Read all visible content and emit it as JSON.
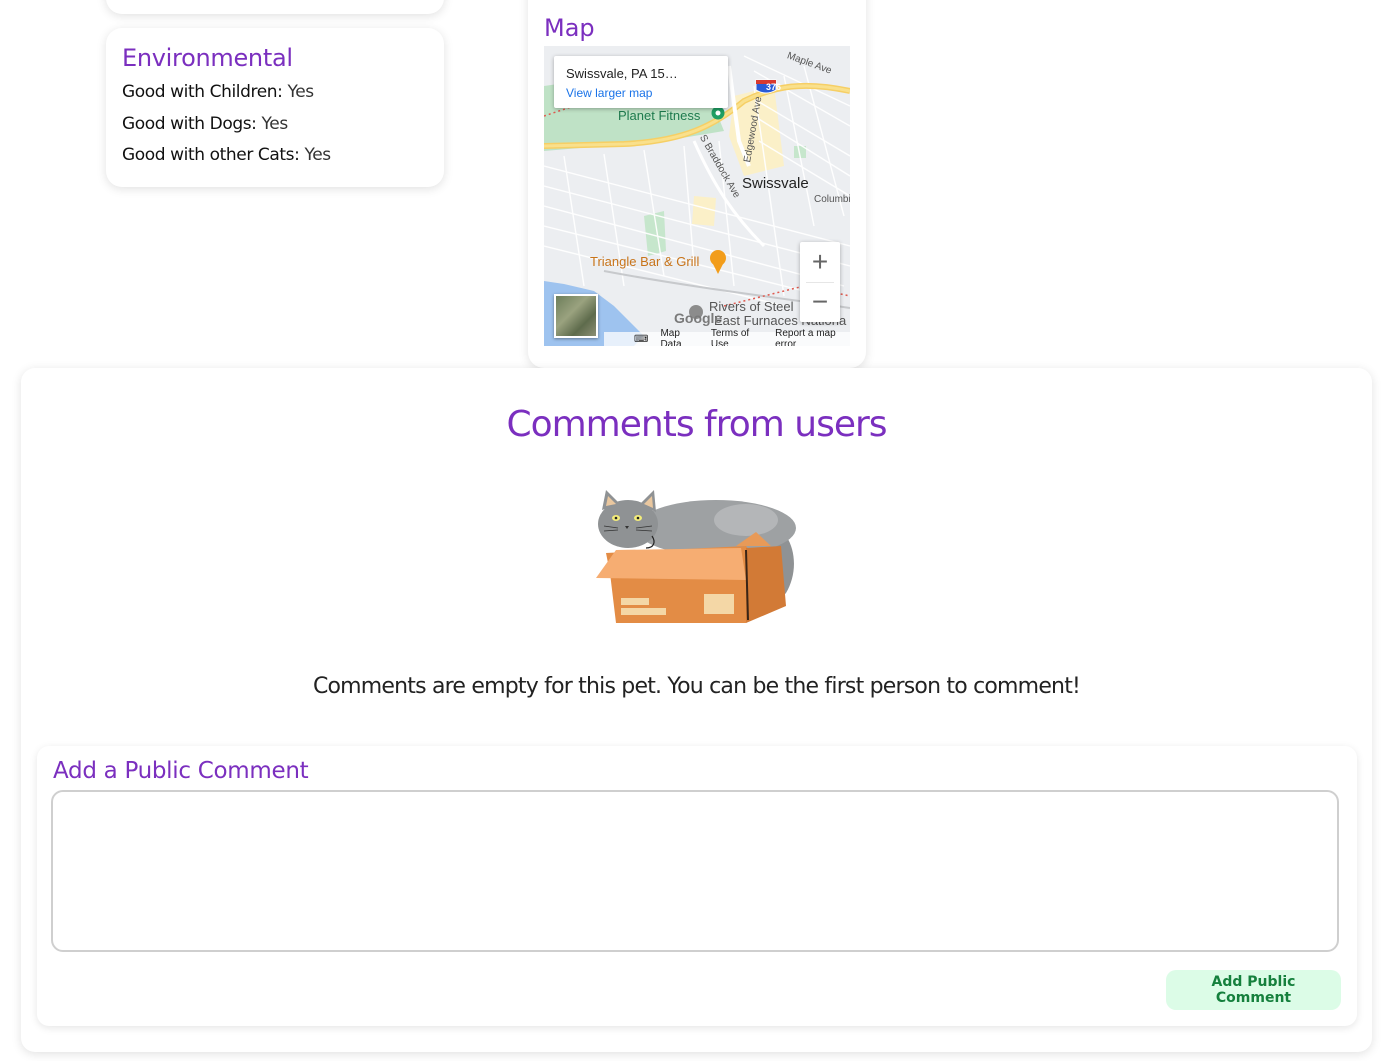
{
  "environmental": {
    "title": "Environmental",
    "rows": [
      {
        "label": "Good with Children:",
        "value": "Yes"
      },
      {
        "label": "Good with Dogs:",
        "value": "Yes"
      },
      {
        "label": "Good with other Cats:",
        "value": "Yes"
      }
    ]
  },
  "map": {
    "title": "Map",
    "place_name": "Swissvale, PA 15…",
    "view_larger": "View larger map",
    "labels": {
      "planet_fitness": "Planet Fitness",
      "swissvale": "Swissvale",
      "triangle_bar": "Triangle Bar & Grill",
      "rivers_of_steel": "Rivers of Steel",
      "east_furnaces": "East Furnaces Nationa",
      "maple_ave": "Maple Ave",
      "braddock_ave": "S Braddock Ave",
      "edgewood_ave": "Edgewood Ave",
      "columbia": "Columbi",
      "interstate": "376",
      "google": "Google"
    },
    "footer": {
      "map_data": "Map Data",
      "terms": "Terms of Use",
      "report": "Report a map error"
    },
    "zoom_in": "+",
    "zoom_out": "−"
  },
  "comments": {
    "title": "Comments from users",
    "empty_message": "Comments are empty for this pet. You can be the first person to comment!",
    "add_title": "Add a Public Comment",
    "textarea_value": "",
    "submit_label": "Add Public Comment"
  }
}
